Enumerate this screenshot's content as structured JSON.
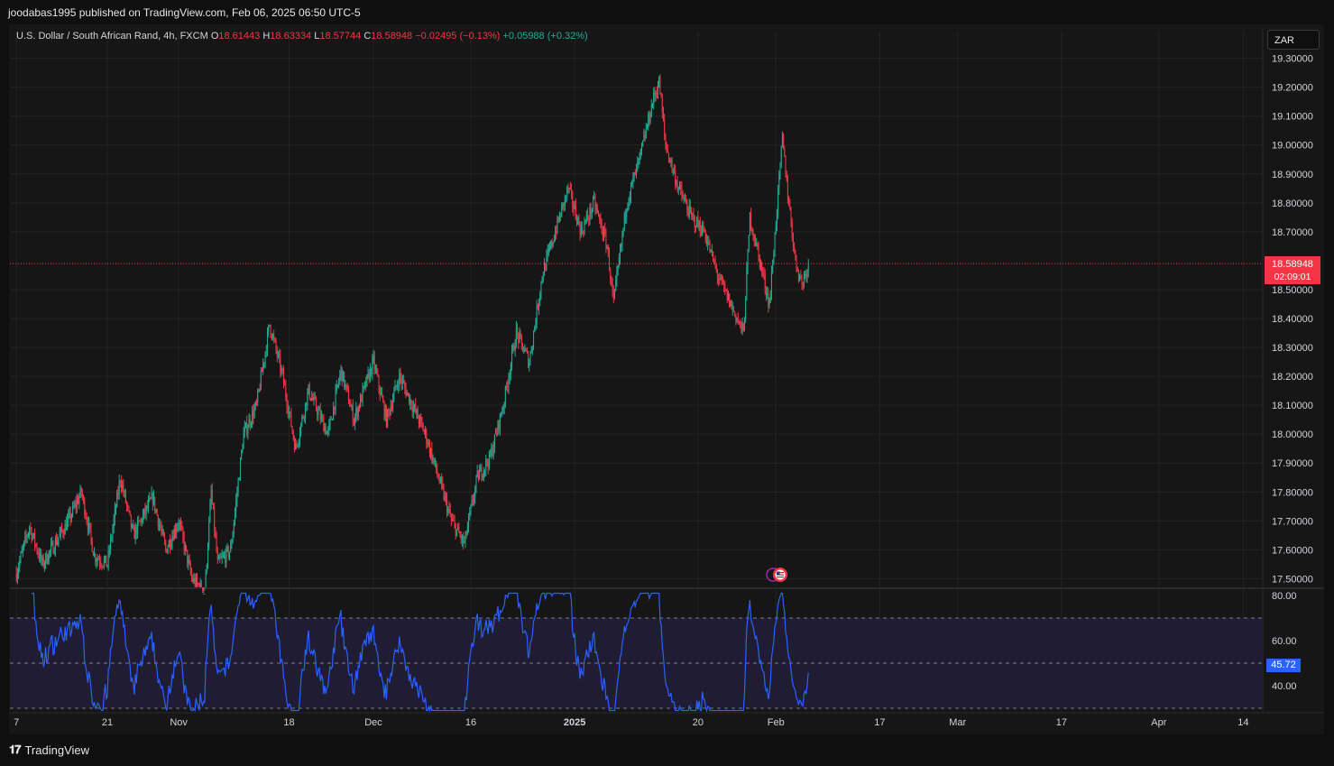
{
  "header": {
    "text": "joodabas1995 published on TradingView.com, Feb 06, 2025 06:50 UTC-5"
  },
  "legend": {
    "symbol": "U.S. Dollar / South African Rand, 4h, FXCM",
    "o_label": "O",
    "o_value": "18.61443",
    "h_label": "H",
    "h_value": "18.63334",
    "l_label": "L",
    "l_value": "18.57744",
    "c_label": "C",
    "c_value": "18.58948",
    "change": "−0.02495 (−0.13%)",
    "extra": "+0.05988 (+0.32%)"
  },
  "currency_button": "ZAR",
  "price_label": {
    "price": "18.58948",
    "countdown": "02:09:01"
  },
  "rsi_label": "45.72",
  "footer": {
    "brand": "TradingView"
  },
  "colors": {
    "up": "#22ab94",
    "down": "#f23645",
    "rsi": "#2962ff",
    "rsi_band": "#1f1c33",
    "grid": "#232323",
    "axis_text": "#d1d4dc"
  },
  "chart_data": {
    "type": "candlestick",
    "price_axis": {
      "ticks": [
        "19.30000",
        "19.20000",
        "19.10000",
        "19.00000",
        "18.90000",
        "18.80000",
        "18.70000",
        "18.50000",
        "18.40000",
        "18.30000",
        "18.20000",
        "18.10000",
        "18.00000",
        "17.90000",
        "17.80000",
        "17.70000",
        "17.60000",
        "17.50000"
      ],
      "ylim": [
        17.47,
        19.33
      ]
    },
    "time_axis": {
      "ticks": [
        "7",
        "21",
        "Nov",
        "18",
        "Dec",
        "16",
        "2025",
        "20",
        "Feb",
        "17",
        "Mar",
        "17",
        "Apr",
        "14"
      ]
    },
    "last_price": 18.58948,
    "price_path": [
      [
        "Oct 7",
        17.52
      ],
      [
        "Oct 9",
        17.68
      ],
      [
        "Oct 11",
        17.55
      ],
      [
        "Oct 15",
        17.7
      ],
      [
        "Oct 17",
        17.8
      ],
      [
        "Oct 19",
        17.58
      ],
      [
        "Oct 21",
        17.55
      ],
      [
        "Oct 23",
        17.85
      ],
      [
        "Oct 25",
        17.65
      ],
      [
        "Oct 28",
        17.78
      ],
      [
        "Oct 30",
        17.6
      ],
      [
        "Nov 1",
        17.7
      ],
      [
        "Nov 3",
        17.5
      ],
      [
        "Nov 5",
        17.45
      ],
      [
        "Nov 6",
        17.8
      ],
      [
        "Nov 7",
        17.55
      ],
      [
        "Nov 9",
        17.6
      ],
      [
        "Nov 11",
        18.0
      ],
      [
        "Nov 13",
        18.1
      ],
      [
        "Nov 15",
        18.38
      ],
      [
        "Nov 17",
        18.2
      ],
      [
        "Nov 19",
        17.95
      ],
      [
        "Nov 21",
        18.15
      ],
      [
        "Nov 24",
        18.0
      ],
      [
        "Nov 26",
        18.22
      ],
      [
        "Nov 28",
        18.05
      ],
      [
        "Dec 1",
        18.25
      ],
      [
        "Dec 3",
        18.05
      ],
      [
        "Dec 5",
        18.2
      ],
      [
        "Dec 7",
        18.1
      ],
      [
        "Dec 9",
        18.0
      ],
      [
        "Dec 11",
        17.85
      ],
      [
        "Dec 13",
        17.7
      ],
      [
        "Dec 15",
        17.62
      ],
      [
        "Dec 17",
        17.85
      ],
      [
        "Dec 19",
        17.92
      ],
      [
        "Dec 21",
        18.1
      ],
      [
        "Dec 23",
        18.35
      ],
      [
        "Dec 25",
        18.25
      ],
      [
        "Dec 27",
        18.55
      ],
      [
        "Dec 29",
        18.7
      ],
      [
        "Dec 31",
        18.85
      ],
      [
        "Jan 2",
        18.7
      ],
      [
        "Jan 4",
        18.8
      ],
      [
        "Jan 6",
        18.65
      ],
      [
        "Jan 7",
        18.45
      ],
      [
        "Jan 9",
        18.8
      ],
      [
        "Jan 11",
        18.95
      ],
      [
        "Jan 13",
        19.15
      ],
      [
        "Jan 14",
        19.22
      ],
      [
        "Jan 15",
        19.0
      ],
      [
        "Jan 17",
        18.85
      ],
      [
        "Jan 19",
        18.75
      ],
      [
        "Jan 21",
        18.7
      ],
      [
        "Jan 23",
        18.55
      ],
      [
        "Jan 25",
        18.45
      ],
      [
        "Jan 27",
        18.35
      ],
      [
        "Jan 28",
        18.75
      ],
      [
        "Jan 30",
        18.55
      ],
      [
        "Jan 31",
        18.45
      ],
      [
        "Feb 2",
        19.02
      ],
      [
        "Feb 3",
        18.8
      ],
      [
        "Feb 4",
        18.6
      ],
      [
        "Feb 5",
        18.52
      ],
      [
        "Feb 6",
        18.59
      ]
    ],
    "rsi": {
      "axis_ticks": [
        "80.00",
        "60.00",
        "40.00"
      ],
      "ylim": [
        28,
        82
      ],
      "bands": [
        30,
        70
      ],
      "mid": 50,
      "last": 45.72
    }
  }
}
